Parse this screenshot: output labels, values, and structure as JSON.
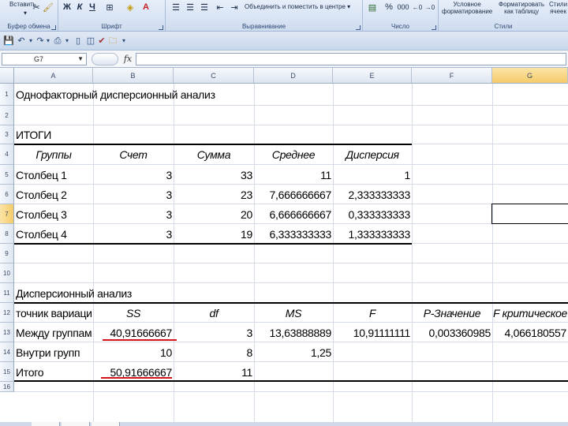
{
  "ribbon": {
    "paste_label": "Вставить",
    "groups": {
      "clipboard": "Буфер обмена",
      "font": "Шрифт",
      "alignment": "Выравнивание",
      "number": "Число",
      "styles": "Стили"
    },
    "bold": "Ж",
    "italic": "К",
    "underline": "Ч",
    "merge_center": "Объединить и поместить в центре",
    "percent": "%",
    "thousands": "000",
    "conditional_format": [
      "Условное",
      "форматирование"
    ],
    "format_as_table": [
      "Форматировать",
      "как таблицу"
    ],
    "cell_styles": [
      "Стили",
      "ячеек"
    ]
  },
  "formula_bar": {
    "name_box": "G7",
    "fx": "fx",
    "value": ""
  },
  "columns": [
    "A",
    "B",
    "C",
    "D",
    "E",
    "F",
    "G"
  ],
  "rows": [
    "1",
    "2",
    "3",
    "4",
    "5",
    "6",
    "7",
    "8",
    "9",
    "10",
    "11",
    "12",
    "13",
    "14",
    "15",
    "16"
  ],
  "cells": {
    "r1": {
      "a": "Однофакторный дисперсионный анализ"
    },
    "r3": {
      "a": "ИТОГИ"
    },
    "r4": {
      "a": "Группы",
      "b": "Счет",
      "c": "Сумма",
      "d": "Среднее",
      "e": "Дисперсия"
    },
    "r5": {
      "a": "Столбец 1",
      "b": "3",
      "c": "33",
      "d": "11",
      "e": "1"
    },
    "r6": {
      "a": "Столбец 2",
      "b": "3",
      "c": "23",
      "d": "7,666666667",
      "e": "2,333333333"
    },
    "r7": {
      "a": "Столбец 3",
      "b": "3",
      "c": "20",
      "d": "6,666666667",
      "e": "0,333333333"
    },
    "r8": {
      "a": "Столбец 4",
      "b": "3",
      "c": "19",
      "d": "6,333333333",
      "e": "1,333333333"
    },
    "r11": {
      "a": "Дисперсионный анализ"
    },
    "r12": {
      "a": "точник вариаци",
      "b": "SS",
      "c": "df",
      "d": "MS",
      "e": "F",
      "f": "P-Значение",
      "g": "F критическое"
    },
    "r13": {
      "a": "Между группам",
      "b": "40,91666667",
      "c": "3",
      "d": "13,63888889",
      "e": "10,91111111",
      "f": "0,003360985",
      "g": "4,066180557"
    },
    "r14": {
      "a": "Внутри групп",
      "b": "10",
      "c": "8",
      "d": "1,25"
    },
    "r15": {
      "a": "Итого",
      "b": "50,91666667",
      "c": "11"
    }
  },
  "colors": {
    "ribbon_bg": "#dbe5f3",
    "header_selected": "#f6cc6a",
    "highlight_underline": "#d3151b"
  }
}
